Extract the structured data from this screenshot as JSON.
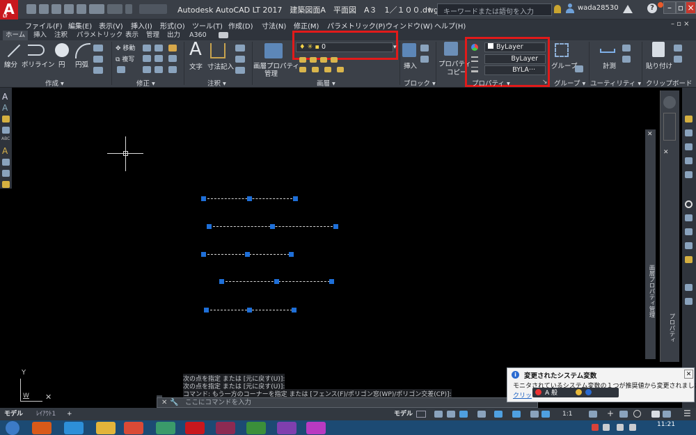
{
  "titlebar": {
    "logo": "A",
    "logo_sub": "LT",
    "title": "Autodesk AutoCAD LT 2017　建築図面A　平面図　A３　1／１００.dwg",
    "search_placeholder": "キーワードまたは語句を入力",
    "user": "wada28530"
  },
  "menu": {
    "items": [
      "ファイル(F)",
      "編集(E)",
      "表示(V)",
      "挿入(I)",
      "形式(O)",
      "ツール(T)",
      "作成(D)",
      "寸法(N)",
      "修正(M)",
      "パラメトリック(P)",
      "ウィンドウ(W)",
      "ヘルプ(H)"
    ]
  },
  "ribbon_tabs": [
    "ホーム",
    "挿入",
    "注釈",
    "パラメトリック",
    "表示",
    "管理",
    "出力",
    "A360"
  ],
  "ribbon": {
    "draw": {
      "line": "線分",
      "polyline": "ポリライン",
      "circle": "円",
      "arc": "円弧",
      "title": "作成 ▾"
    },
    "modify": {
      "move": "移動",
      "copy": "複写",
      "title": "修正 ▾"
    },
    "annotation": {
      "text": "文字",
      "dimension": "寸法記入",
      "title": "注釈 ▾"
    },
    "layers": {
      "layer_props_1": "画層プロパティ",
      "layer_props_2": "管理",
      "current_layer": "0",
      "title": "画層 ▾"
    },
    "block": {
      "insert": "挿入",
      "title": "ブロック ▾"
    },
    "properties": {
      "match_1": "プロパティ",
      "match_2": "コピー",
      "color": "ByLayer",
      "linetype": "ByLayer",
      "lineweight": "BYLA···",
      "title": "プロパティ ▾"
    },
    "groups": {
      "group": "グループ",
      "title": "グループ ▾"
    },
    "utilities": {
      "measure": "計測",
      "title": "ユーティリティ ▾"
    },
    "clipboard": {
      "paste": "貼り付け",
      "title": "クリップボード"
    }
  },
  "palettes": {
    "layer_props": "画層プロパティ管理",
    "properties": "プロパティ"
  },
  "command": {
    "history": [
      "次の点を指定 または [元に戻す(U)]:",
      "次の点を指定 または [元に戻す(U)]:",
      "コマンド: もう一方のコーナーを指定 または [フェンス(F)/ポリゴン窓(WP)/ポリゴン交差(CP)]:"
    ],
    "placeholder": "ここにコマンドを入力"
  },
  "notification": {
    "title": "変更されたシステム変数",
    "body": "モニタされているシステム変数の１つが推奨値から変更されました",
    "link": "クリッ"
  },
  "ucs": {
    "y": "Y",
    "w": "W"
  },
  "layout_tabs": [
    "モデル",
    "ﾚｲｱｳﾄ1",
    "+"
  ],
  "status": {
    "model": "モデル",
    "scale": "1:1"
  },
  "taskbar": {
    "clock": "11:21"
  },
  "colors": {
    "highlight": "#e11a1a",
    "grip": "#1e6fd8",
    "logo": "#c8171d",
    "canvas": "#000000"
  }
}
